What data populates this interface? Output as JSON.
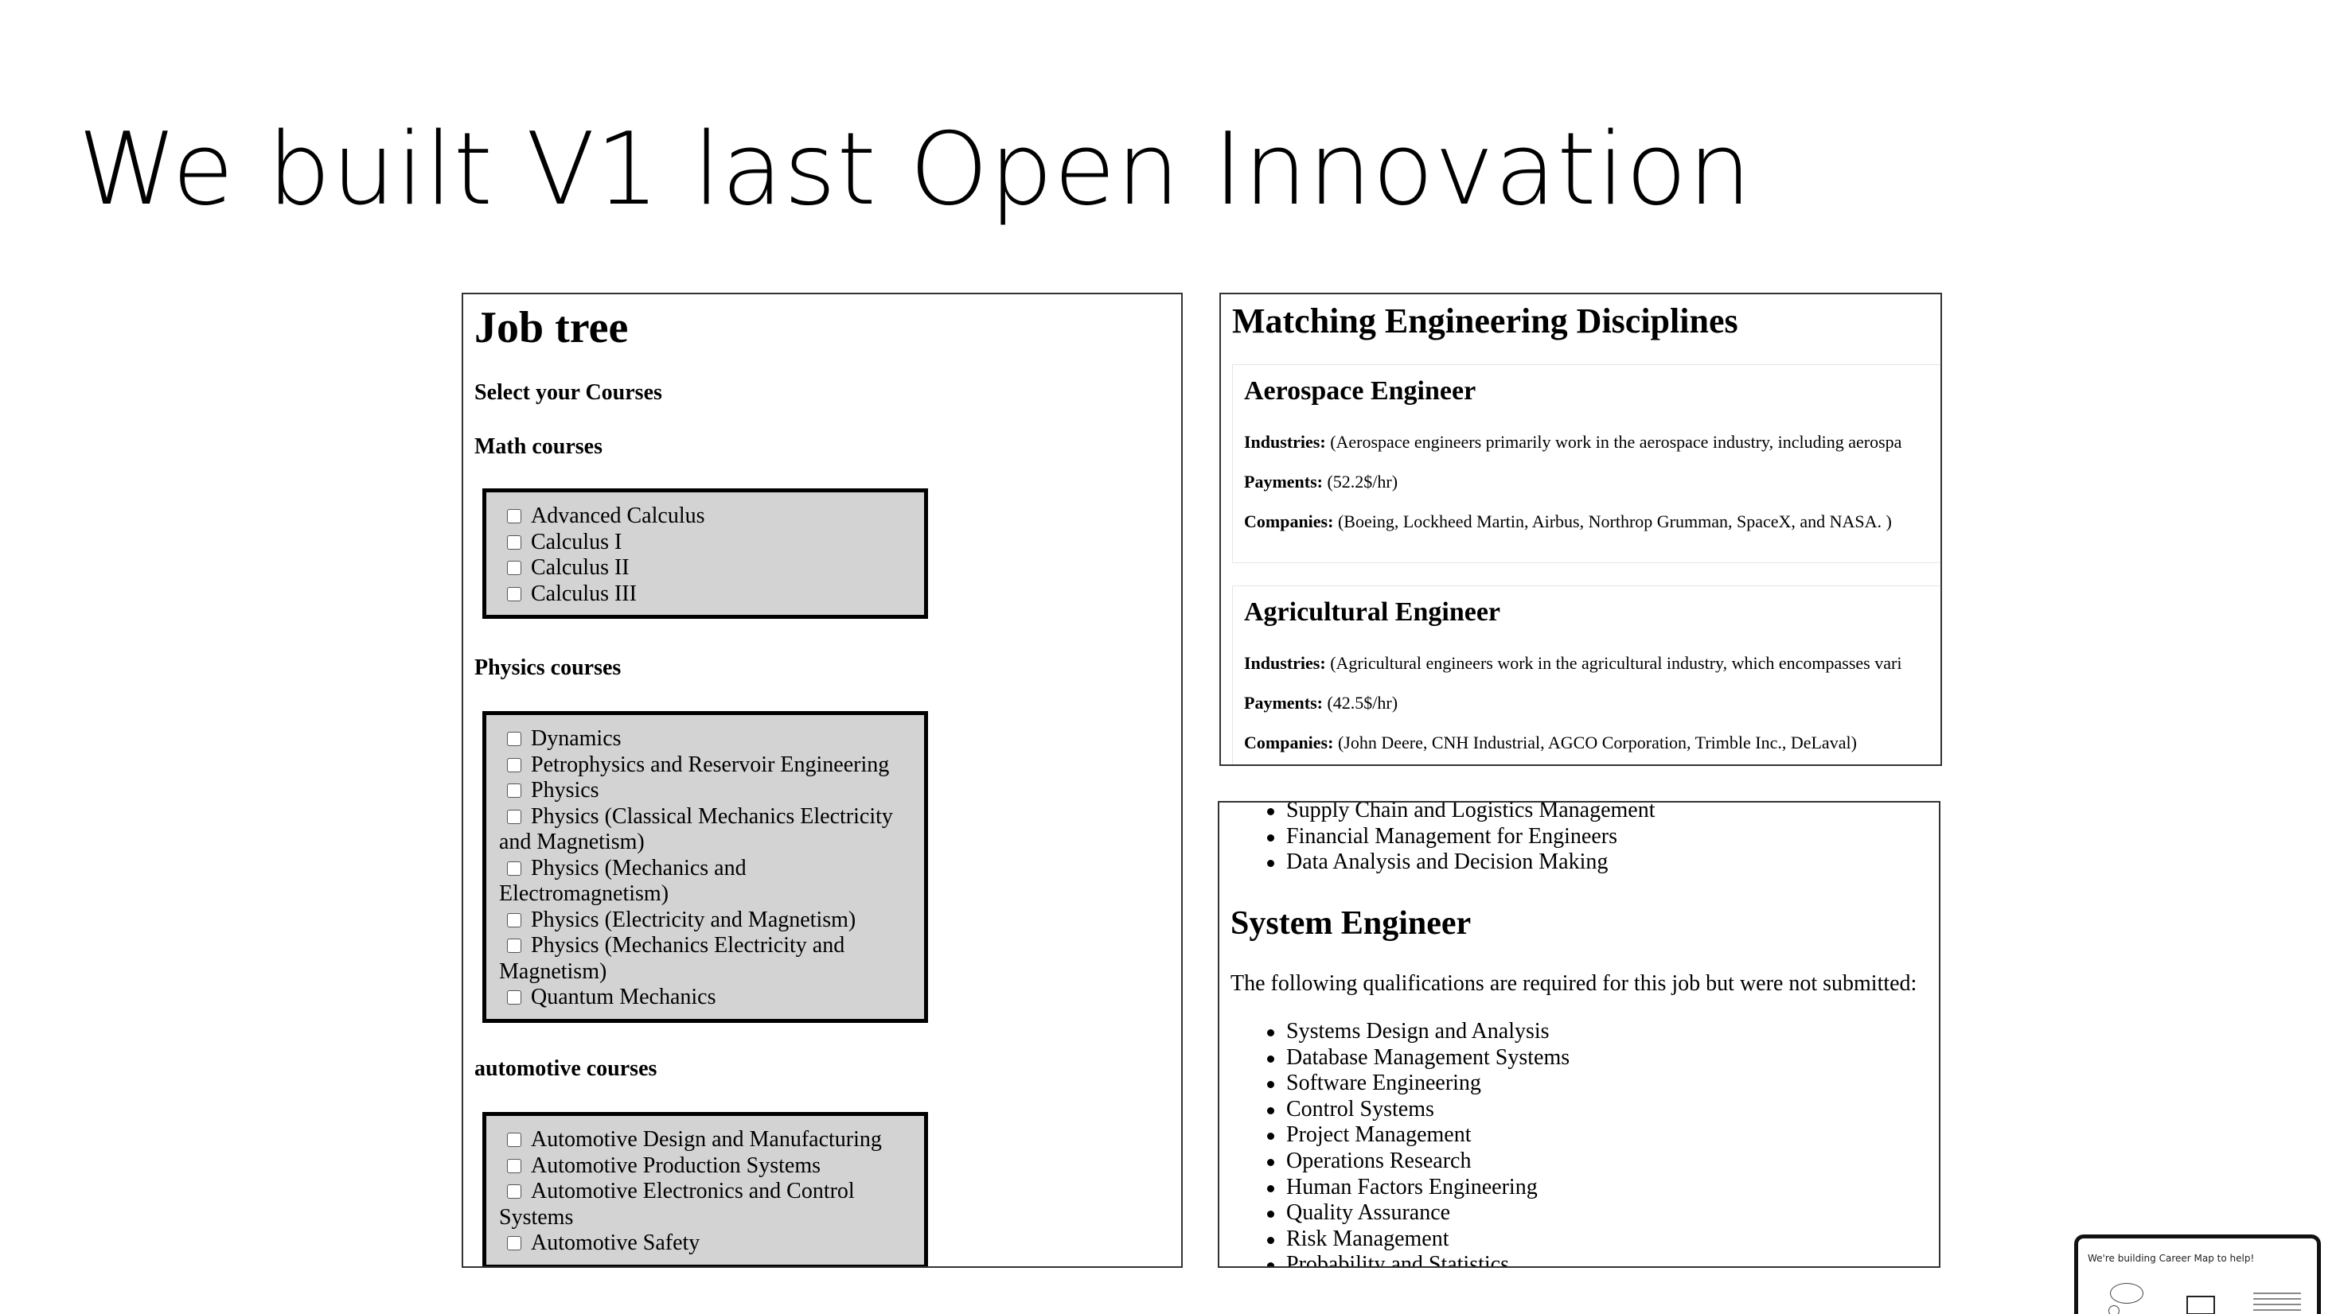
{
  "slide": {
    "title": "We built V1 last Open Innovation"
  },
  "job_tree": {
    "title": "Job tree",
    "select_label": "Select your Courses",
    "groups": [
      {
        "heading": "Math courses",
        "items": [
          "Advanced Calculus",
          "Calculus I",
          "Calculus II",
          "Calculus III"
        ]
      },
      {
        "heading": "Physics courses",
        "items": [
          "Dynamics",
          "Petrophysics and Reservoir Engineering",
          "Physics",
          "Physics (Classical Mechanics Electricity and Magnetism)",
          "Physics (Mechanics and Electromagnetism)",
          "Physics (Electricity and Magnetism)",
          "Physics (Mechanics Electricity and Magnetism)",
          "Quantum Mechanics"
        ]
      },
      {
        "heading": "automotive courses",
        "items": [
          "Automotive Design and Manufacturing",
          "Automotive Production Systems",
          "Automotive Electronics and Control Systems",
          "Automotive Safety"
        ]
      }
    ]
  },
  "matching": {
    "title": "Matching Engineering Disciplines",
    "industries_label": "Industries:",
    "payments_label": "Payments:",
    "companies_label": "Companies:",
    "cards": [
      {
        "name": "Aerospace Engineer",
        "industries": "(Aerospace engineers primarily work in the aerospace industry, including aerospa",
        "payments": "(52.2$/hr)",
        "companies": "(Boeing, Lockheed Martin, Airbus, Northrop Grumman, SpaceX, and NASA. )"
      },
      {
        "name": "Agricultural Engineer",
        "industries": "(Agricultural engineers work in the agricultural industry, which encompasses vari",
        "payments": "(42.5$/hr)",
        "companies": "(John Deere, CNH Industrial, AGCO Corporation, Trimble Inc., DeLaval)"
      }
    ]
  },
  "requirements": {
    "top_items": [
      "Supply Chain and Logistics Management",
      "Financial Management for Engineers",
      "Data Analysis and Decision Making"
    ],
    "job_title": "System Engineer",
    "message": "The following qualifications are required for this job but were not submitted:",
    "items": [
      "Systems Design and Analysis",
      "Database Management Systems",
      "Software Engineering",
      "Control Systems",
      "Project Management",
      "Operations Research",
      "Human Factors Engineering",
      "Quality Assurance",
      "Risk Management",
      "Probability and Statistics"
    ]
  },
  "thumbnail": {
    "text": "We're building Career Map to help!"
  }
}
